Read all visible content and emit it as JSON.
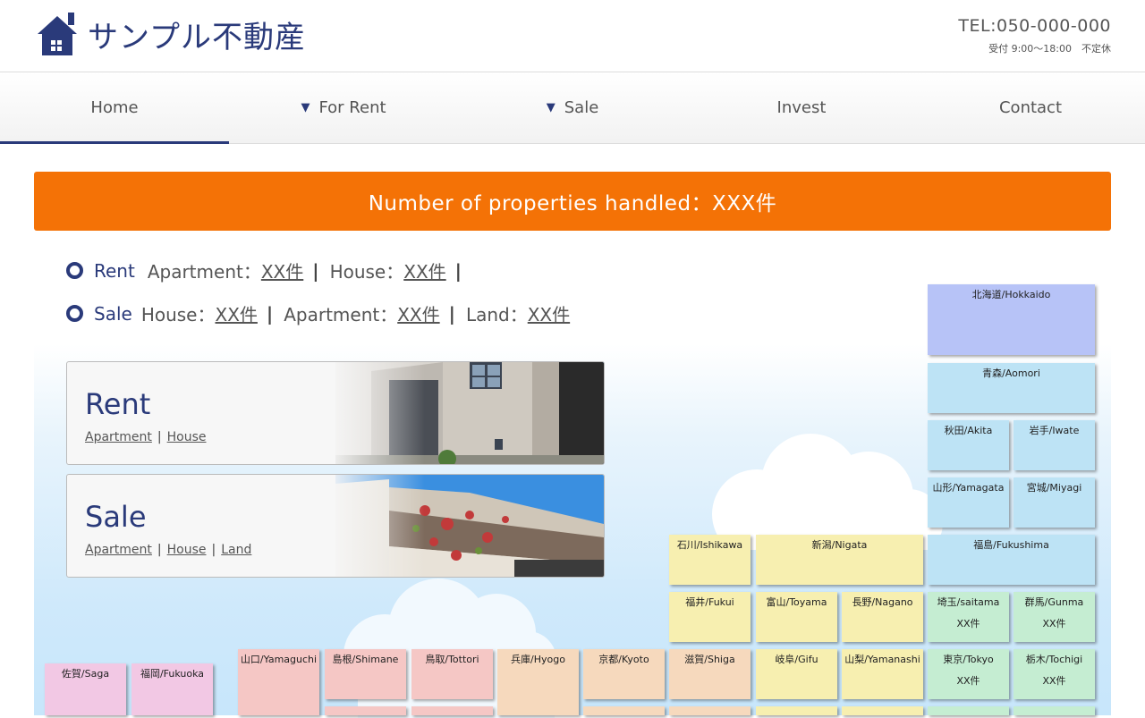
{
  "header": {
    "logo_text": "サンプル不動産",
    "tel": "TEL:050-000-000",
    "hours": "受付 9:00～18:00　不定休"
  },
  "nav": {
    "items": [
      {
        "label": "Home",
        "dropdown": false,
        "active": true
      },
      {
        "label": "For Rent",
        "dropdown": true,
        "active": false
      },
      {
        "label": "Sale",
        "dropdown": true,
        "active": false
      },
      {
        "label": "Invest",
        "dropdown": false,
        "active": false
      },
      {
        "label": "Contact",
        "dropdown": false,
        "active": false
      }
    ],
    "arrow_icon": "triangle-down-icon"
  },
  "banner": {
    "text": "Number of properties handled：XXX件"
  },
  "counts": {
    "rent": {
      "title": "Rent",
      "items": [
        {
          "label": "Apartment：",
          "value": "XX件"
        },
        {
          "label": "House：",
          "value": "XX件"
        }
      ]
    },
    "sale": {
      "title": "Sale",
      "items": [
        {
          "label": "House：",
          "value": "XX件"
        },
        {
          "label": "Apartment：",
          "value": "XX件"
        },
        {
          "label": "Land：",
          "value": "XX件"
        }
      ]
    }
  },
  "cards": {
    "rent": {
      "title": "Rent",
      "links": [
        "Apartment",
        "House"
      ]
    },
    "sale": {
      "title": "Sale",
      "links": [
        "Apartment",
        "House",
        "Land"
      ]
    }
  },
  "prefectures": [
    {
      "name": "北海道/Hokkaido",
      "color": "blue"
    },
    {
      "name": "青森/Aomori",
      "color": "sky"
    },
    {
      "name": "秋田/Akita",
      "color": "sky"
    },
    {
      "name": "岩手/Iwate",
      "color": "sky"
    },
    {
      "name": "山形/Yamagata",
      "color": "sky"
    },
    {
      "name": "宮城/Miyagi",
      "color": "sky"
    },
    {
      "name": "石川/Ishikawa",
      "color": "yellow"
    },
    {
      "name": "新潟/Nigata",
      "color": "yellow"
    },
    {
      "name": "福島/Fukushima",
      "color": "sky"
    },
    {
      "name": "福井/Fukui",
      "color": "yellow"
    },
    {
      "name": "富山/Toyama",
      "color": "yellow"
    },
    {
      "name": "長野/Nagano",
      "color": "yellow"
    },
    {
      "name": "埼玉/saitama",
      "color": "green",
      "count": "XX件"
    },
    {
      "name": "群馬/Gunma",
      "color": "green",
      "count": "XX件"
    },
    {
      "name": "佐賀/Saga",
      "color": "magenta"
    },
    {
      "name": "福岡/Fukuoka",
      "color": "magenta"
    },
    {
      "name": "山口/Yamaguchi",
      "color": "pink"
    },
    {
      "name": "島根/Shimane",
      "color": "pink"
    },
    {
      "name": "鳥取/Tottori",
      "color": "pink"
    },
    {
      "name": "兵庫/Hyogo",
      "color": "peach"
    },
    {
      "name": "京都/Kyoto",
      "color": "peach"
    },
    {
      "name": "滋賀/Shiga",
      "color": "peach"
    },
    {
      "name": "岐阜/Gifu",
      "color": "yellow"
    },
    {
      "name": "山梨/Yamanashi",
      "color": "yellow"
    },
    {
      "name": "東京/Tokyo",
      "color": "green",
      "count": "XX件"
    },
    {
      "name": "栃木/Tochigi",
      "color": "green",
      "count": "XX件"
    },
    {
      "name": "",
      "color": "pink"
    },
    {
      "name": "",
      "color": "pink"
    },
    {
      "name": "",
      "color": "peach"
    },
    {
      "name": "",
      "color": "peach"
    },
    {
      "name": "",
      "color": "yellow"
    },
    {
      "name": "",
      "color": "yellow"
    },
    {
      "name": "",
      "color": "green"
    },
    {
      "name": "",
      "color": "green"
    }
  ]
}
